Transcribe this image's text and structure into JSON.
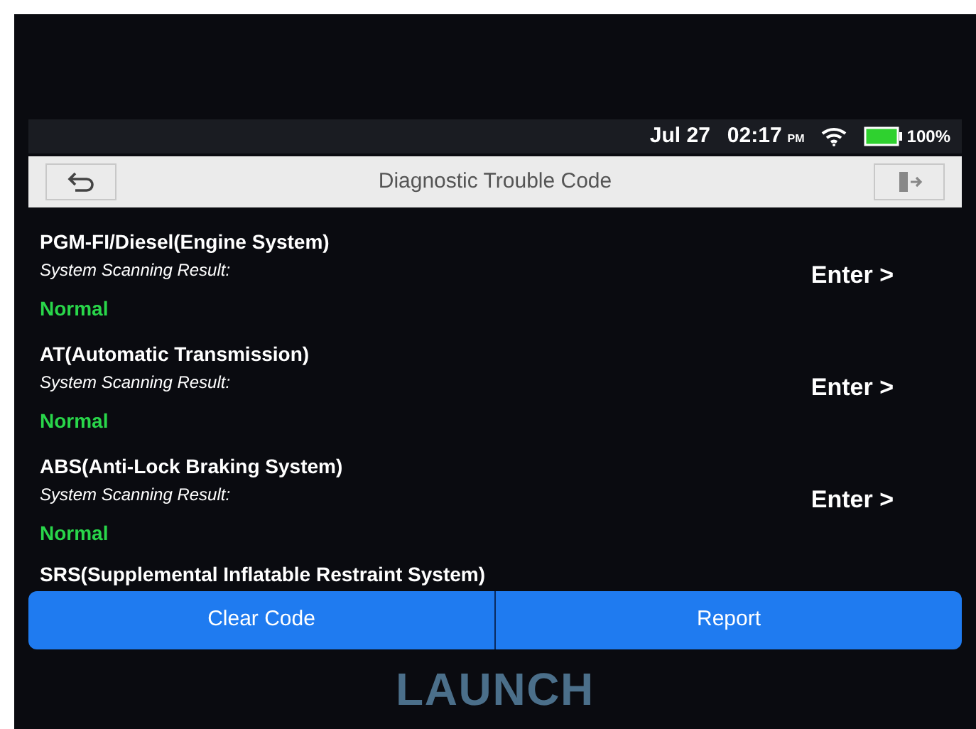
{
  "status_bar": {
    "date": "Jul 27",
    "time": "02:17",
    "ampm": "PM",
    "battery": "100%"
  },
  "title_bar": {
    "title": "Diagnostic Trouble Code"
  },
  "systems": [
    {
      "name": "PGM-FI/Diesel(Engine System)",
      "label": "System Scanning Result:",
      "result": "Normal",
      "action": "Enter >"
    },
    {
      "name": "AT(Automatic Transmission)",
      "label": "System Scanning Result:",
      "result": "Normal",
      "action": "Enter >"
    },
    {
      "name": "ABS(Anti-Lock Braking System)",
      "label": "System Scanning Result:",
      "result": "Normal",
      "action": "Enter >"
    },
    {
      "name": "SRS(Supplemental Inflatable Restraint System)"
    }
  ],
  "buttons": [
    "Clear Code",
    "Report"
  ],
  "brand": "LAUNCH"
}
